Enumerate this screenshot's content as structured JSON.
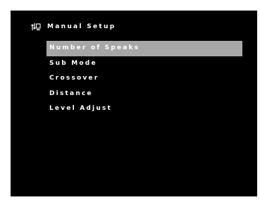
{
  "header": {
    "icon": "speaker-setup-icon",
    "title": "Manual Setup"
  },
  "menu": {
    "items": [
      {
        "label": "Number of Speaks",
        "selected": true
      },
      {
        "label": "Sub Mode",
        "selected": false
      },
      {
        "label": "Crossover",
        "selected": false
      },
      {
        "label": "Distance",
        "selected": false
      },
      {
        "label": "Level Adjust",
        "selected": false
      }
    ]
  },
  "colors": {
    "background": "#000000",
    "text": "#ffffff",
    "highlight": "#a7a7a7",
    "frame": "#ffffff"
  }
}
